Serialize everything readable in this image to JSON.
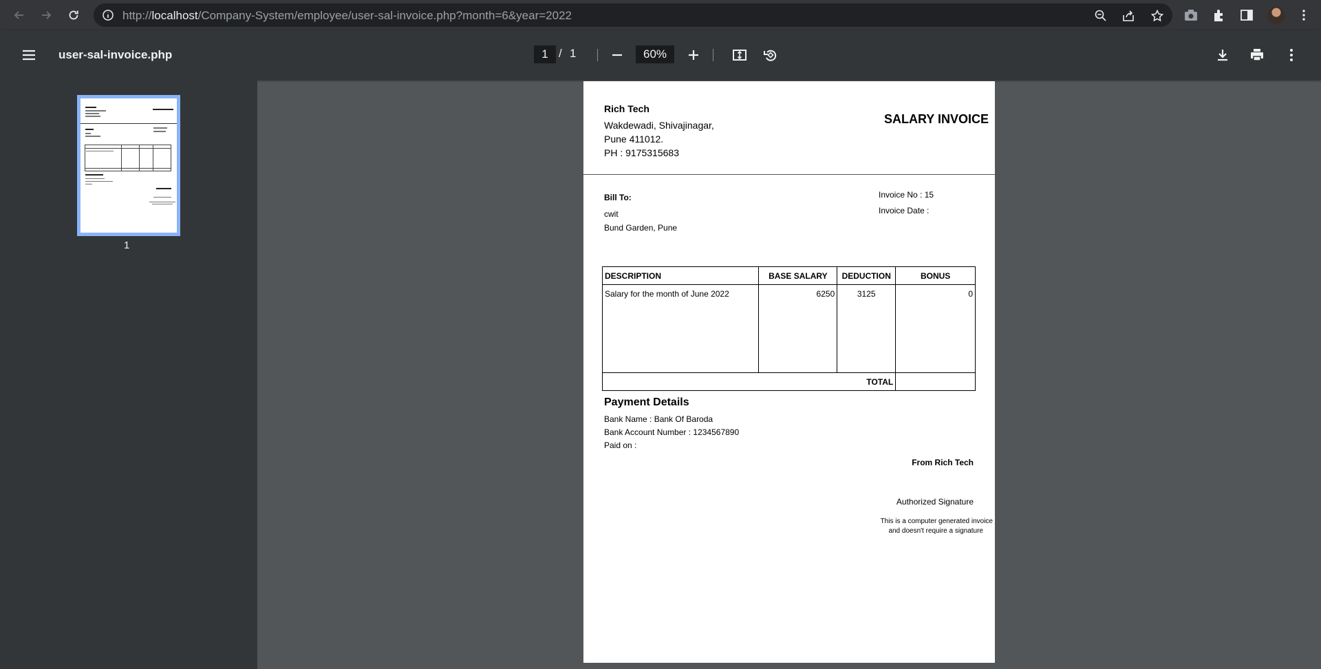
{
  "browser": {
    "url_prefix": "http://",
    "url_host": "localhost",
    "url_path": "/Company-System/employee/user-sal-invoice.php?month=6&year=2022"
  },
  "pdf_toolbar": {
    "title": "user-sal-invoice.php",
    "current_page": "1",
    "page_separator": "/",
    "total_pages": "1",
    "zoom": "60%"
  },
  "sidebar": {
    "thumbnail_label": "1"
  },
  "invoice": {
    "company_name": "Rich Tech",
    "address_line1": "Wakdewadi, Shivajinagar,",
    "address_line2": "Pune 411012.",
    "phone": "PH : 9175315683",
    "doc_title": "SALARY INVOICE",
    "bill_to_label": "Bill To:",
    "bill_to_name": "cwit",
    "bill_to_address": "Bund Garden, Pune",
    "invoice_no": "Invoice No : 15",
    "invoice_date": "Invoice Date :",
    "table": {
      "headers": [
        "DESCRIPTION",
        "BASE SALARY",
        "DEDUCTION",
        "BONUS"
      ],
      "row": {
        "description": "Salary for the month of June 2022",
        "base_salary": "6250",
        "deduction": "3125",
        "bonus": "0"
      },
      "total_label": "TOTAL",
      "total_value": ""
    },
    "payment_title": "Payment Details",
    "bank_name": "Bank Name : Bank Of Baroda",
    "bank_account": "Bank Account Number : 1234567890",
    "paid_on": "Paid on :",
    "from_company": "From Rich Tech",
    "authorized_signature": "Authorized Signature",
    "note_line1": "This is a computer generated invoice",
    "note_line2": "and doesn't require a signature"
  }
}
